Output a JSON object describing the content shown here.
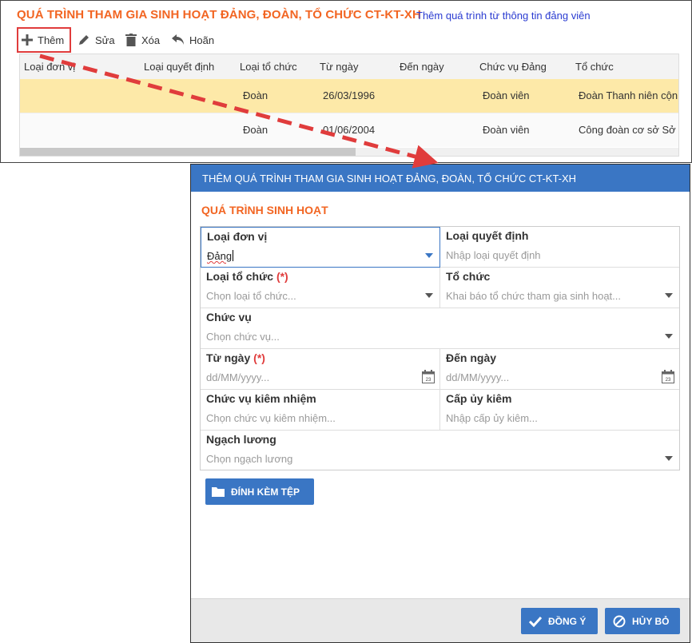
{
  "top_panel": {
    "title": "QUÁ TRÌNH THAM GIA SINH HOẠT ĐẢNG, ĐOÀN, TỔ CHỨC CT-KT-XH",
    "link_text": "Thêm quá trình từ thông tin đảng viên",
    "toolbar": {
      "add": "Thêm",
      "edit": "Sửa",
      "delete": "Xóa",
      "undo": "Hoãn"
    },
    "grid": {
      "columns": [
        "Loại đơn vị",
        "Loại quyết định",
        "Loại tổ chức",
        "Từ ngày",
        "Đến ngày",
        "Chức vụ Đảng",
        "Tổ chức"
      ],
      "rows": [
        {
          "loai_don_vi": "",
          "loai_quyet_dinh": "",
          "loai_to_chuc": "Đoàn",
          "tu_ngay": "26/03/1996",
          "den_ngay": "",
          "chuc_vu": "Đoàn viên",
          "to_chuc": "Đoàn Thanh niên cộn..."
        },
        {
          "loai_don_vi": "",
          "loai_quyet_dinh": "",
          "loai_to_chuc": "Đoàn",
          "tu_ngay": "01/06/2004",
          "den_ngay": "",
          "chuc_vu": "Đoàn viên",
          "to_chuc": "Công đoàn cơ sở Sở ..."
        }
      ]
    }
  },
  "dialog": {
    "title": "THÊM QUÁ TRÌNH THAM GIA SINH HOẠT ĐẢNG, ĐOÀN, TỔ CHỨC CT-KT-XH",
    "section_title": "QUÁ TRÌNH SINH HOẠT",
    "fields": {
      "loai_don_vi": {
        "label": "Loại đơn vị",
        "value": "Đảng"
      },
      "loai_quyet_dinh": {
        "label": "Loại quyết định",
        "placeholder": "Nhập loại quyết định"
      },
      "loai_to_chuc": {
        "label": "Loại tổ chức",
        "required": "(*)",
        "placeholder": "Chọn loại tổ chức..."
      },
      "to_chuc": {
        "label": "Tổ chức",
        "placeholder": "Khai báo tổ chức tham gia sinh hoạt..."
      },
      "chuc_vu": {
        "label": "Chức vụ",
        "placeholder": "Chọn chức vụ..."
      },
      "tu_ngay": {
        "label": "Từ ngày",
        "required": "(*)",
        "placeholder": "dd/MM/yyyy..."
      },
      "den_ngay": {
        "label": "Đến ngày",
        "placeholder": "dd/MM/yyyy..."
      },
      "chuc_vu_kiem_nhiem": {
        "label": "Chức vụ kiêm nhiệm",
        "placeholder": "Chọn chức vụ kiêm nhiệm..."
      },
      "cap_uy_kiem": {
        "label": "Cấp ủy kiêm",
        "placeholder": "Nhập cấp ủy kiêm..."
      },
      "ngach_luong": {
        "label": "Ngạch lương",
        "placeholder": "Chọn ngạch lương"
      }
    },
    "attach_label": "ĐÍNH KÈM TỆP",
    "calendar_day": "23",
    "buttons": {
      "ok": "ĐỒNG Ý",
      "cancel": "HỦY BỎ"
    }
  },
  "colors": {
    "title_orange": "#f26522",
    "primary_blue": "#3a76c4",
    "selected_row": "#fde9a8",
    "highlight_red": "#e03c3c"
  }
}
